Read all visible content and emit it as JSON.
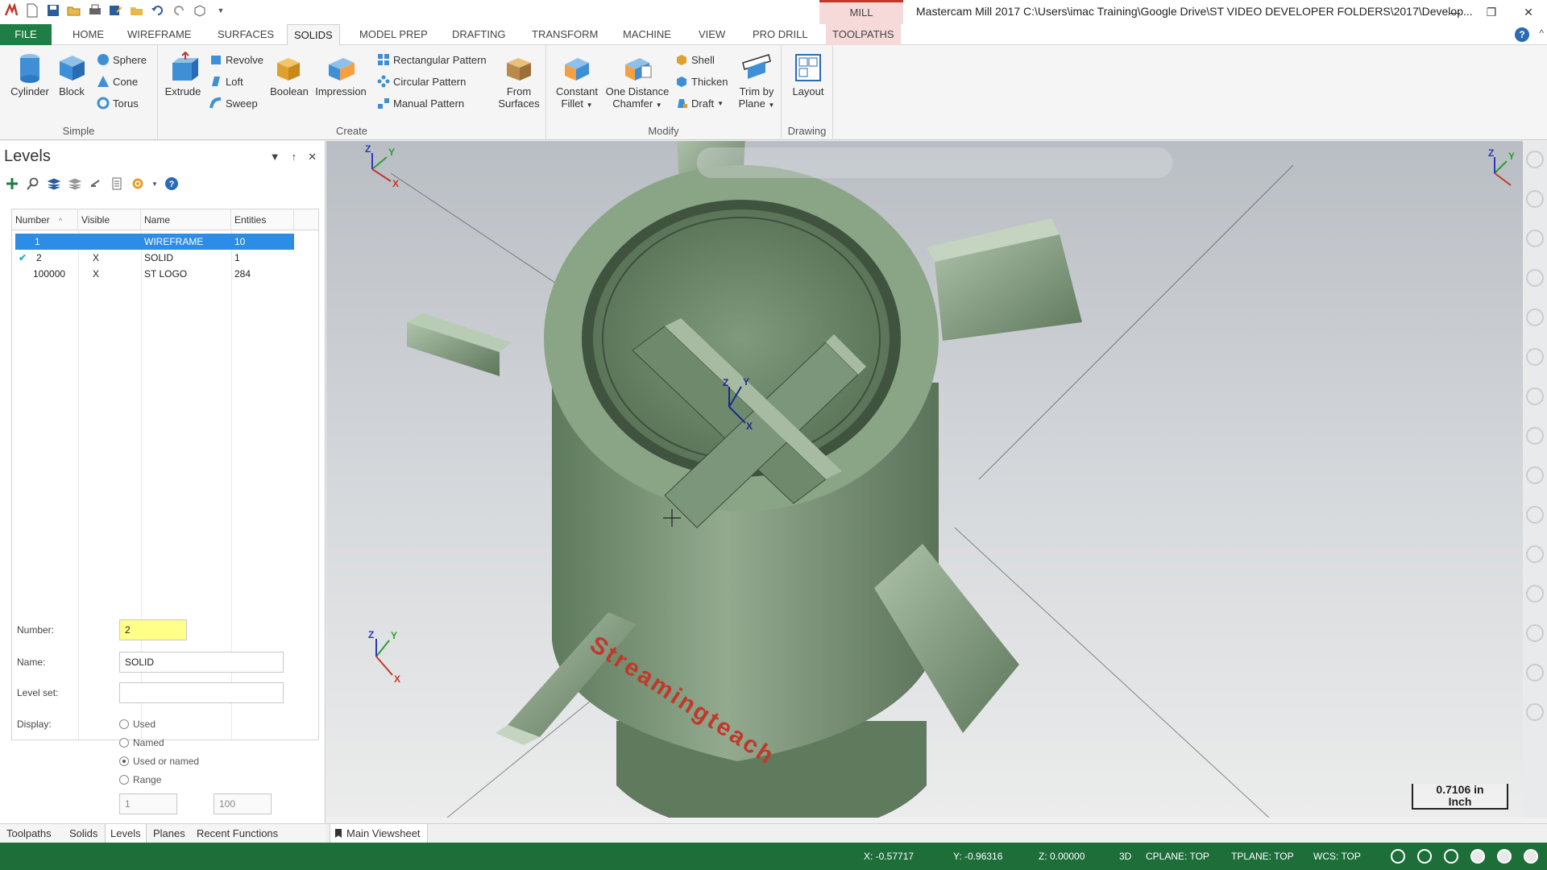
{
  "window": {
    "context_tab": "MILL",
    "title": "Mastercam Mill 2017  C:\\Users\\imac Training\\Google Drive\\ST VIDEO DEVELOPER FOLDERS\\2017\\Develop..."
  },
  "menu": {
    "tabs": [
      "FILE",
      "HOME",
      "WIREFRAME",
      "SURFACES",
      "SOLIDS",
      "MODEL PREP",
      "DRAFTING",
      "TRANSFORM",
      "MACHINE",
      "VIEW",
      "PRO DRILL",
      "TOOLPATHS"
    ],
    "active": "SOLIDS"
  },
  "ribbon": {
    "simple": {
      "label": "Simple",
      "cylinder": "Cylinder",
      "block": "Block",
      "sphere": "Sphere",
      "cone": "Cone",
      "torus": "Torus"
    },
    "create": {
      "label": "Create",
      "extrude": "Extrude",
      "revolve": "Revolve",
      "loft": "Loft",
      "sweep": "Sweep",
      "boolean": "Boolean",
      "impression": "Impression",
      "rect_pattern": "Rectangular Pattern",
      "circ_pattern": "Circular Pattern",
      "manual_pattern": "Manual Pattern",
      "from_surfaces_1": "From",
      "from_surfaces_2": "Surfaces"
    },
    "modify": {
      "label": "Modify",
      "const_fillet_1": "Constant",
      "const_fillet_2": "Fillet",
      "one_dist_1": "One Distance",
      "one_dist_2": "Chamfer",
      "shell": "Shell",
      "thicken": "Thicken",
      "draft": "Draft",
      "trim_1": "Trim by",
      "trim_2": "Plane"
    },
    "drawing": {
      "label": "Drawing",
      "layout": "Layout"
    }
  },
  "levels": {
    "title": "Levels",
    "columns": [
      "Number",
      "Visible",
      "Name",
      "Entities"
    ],
    "rows": [
      {
        "number": "1",
        "visible": "",
        "name": "WIREFRAME",
        "entities": "10"
      },
      {
        "number": "2",
        "visible": "X",
        "name": "SOLID",
        "entities": "1"
      },
      {
        "number": "100000",
        "visible": "X",
        "name": "ST LOGO",
        "entities": "284"
      }
    ],
    "form": {
      "number_label": "Number:",
      "number_value": "2",
      "name_label": "Name:",
      "name_value": "SOLID",
      "levelset_label": "Level set:",
      "levelset_value": "",
      "display_label": "Display:",
      "options": [
        "Used",
        "Named",
        "Used or named",
        "Range"
      ],
      "selected_option": "Used or named",
      "range_from": "1",
      "range_to": "100"
    }
  },
  "bottom_tabs": [
    "Toolpaths",
    "Solids",
    "Levels",
    "Planes",
    "Recent Functions"
  ],
  "active_bottom_tab": "Levels",
  "viewport": {
    "scale_value": "0.7106 in",
    "scale_unit": "Inch",
    "watermark": "Streamingteach"
  },
  "viewsheet": "Main Viewsheet",
  "status": {
    "x": "X:  -0.57717",
    "y": "Y:  -0.96316",
    "z": "Z:  0.00000",
    "mode": "3D",
    "cplane": "CPLANE: TOP",
    "tplane": "TPLANE: TOP",
    "wcs": "WCS: TOP"
  },
  "colors": {
    "accent_green": "#1e7e45",
    "selection_blue": "#2d8ce6",
    "model_green": "#7f9a7c"
  }
}
